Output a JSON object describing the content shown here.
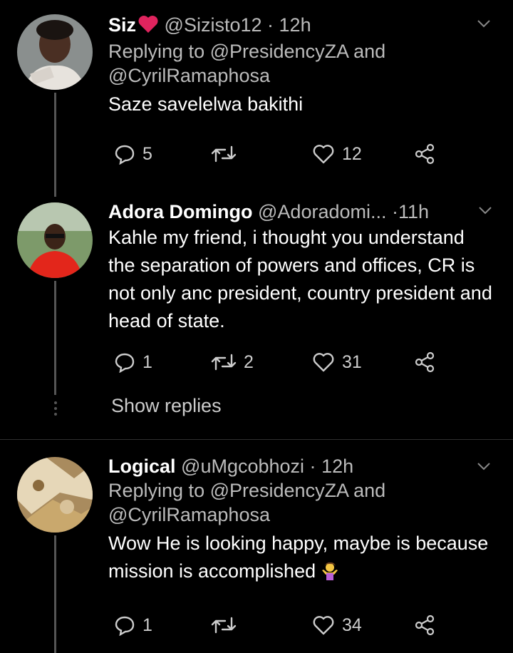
{
  "tweets": [
    {
      "name": "Siz",
      "handle": "@Sizisto12",
      "separator": "·",
      "time": "12h",
      "replying_prefix": "Replying to ",
      "replying_to_1": "@PresidencyZA",
      "replying_and": " and",
      "replying_to_2": "@CyrilRamaphosa",
      "text": "Saze savelelwa bakithi",
      "replies": "5",
      "retweets": "",
      "likes": "12"
    },
    {
      "name": "Adora Domingo",
      "handle": "@Adoradomi...",
      "separator": "·",
      "time": "11h",
      "text": "Kahle my friend, i thought you understand the separation of powers and offices, CR is not only anc president, country president and head of state.",
      "replies": "1",
      "retweets": "2",
      "likes": "31"
    },
    {
      "name": "Logical",
      "handle": "@uMgcobhozi",
      "separator": "·",
      "time": "12h",
      "replying_prefix": "Replying to ",
      "replying_to_1": "@PresidencyZA",
      "replying_and": " and",
      "replying_to_2": "@CyrilRamaphosa",
      "text": "Wow He is looking happy, maybe is because mission is accomplished",
      "replies": "1",
      "retweets": "",
      "likes": "34"
    }
  ],
  "show_replies_label": "Show replies",
  "colors": {
    "background": "#000000",
    "secondary_text": "#bbbbbb",
    "heart_emoji": "#e0245e",
    "thread_line": "#555555"
  },
  "icons": {
    "reply": "reply-icon",
    "retweet": "retweet-icon",
    "like": "heart-icon",
    "share": "share-icon",
    "more": "chevron-down-icon"
  }
}
